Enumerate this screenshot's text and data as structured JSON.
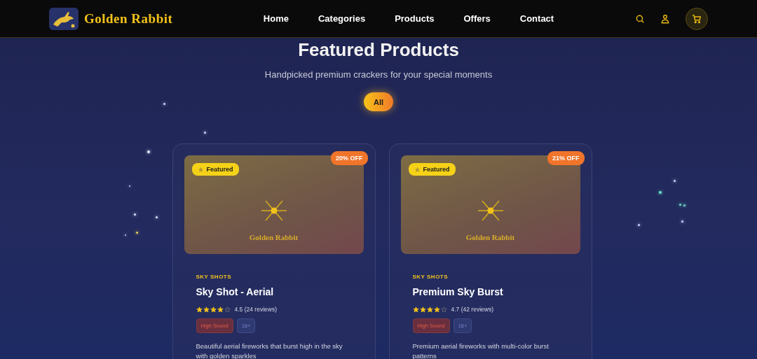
{
  "header": {
    "brand": "Golden Rabbit",
    "nav": [
      {
        "label": "Home",
        "selected": false
      },
      {
        "label": "Categories",
        "selected": false
      },
      {
        "label": "Products",
        "selected": false
      },
      {
        "label": "Offers",
        "selected": false
      },
      {
        "label": "Contact",
        "selected": false
      }
    ]
  },
  "section": {
    "title": "Featured Products",
    "subtitle": "Handpicked premium crackers for your special moments"
  },
  "filters": [
    {
      "label": "All",
      "selected": true
    }
  ],
  "products": [
    {
      "badge": "Featured",
      "discount": "20% OFF",
      "image_brand": "Golden Rabbit",
      "category": "SKY SHOTS",
      "name": "Sky Shot - Aerial",
      "stars": 4,
      "rating": "4.5 (24 reviews)",
      "tags": [
        {
          "label": "High Sound",
          "kind": "warning"
        },
        {
          "label": "18+",
          "kind": "info"
        }
      ],
      "description": "Beautiful aerial fireworks that burst high in the sky with golden sparkles"
    },
    {
      "badge": "Featured",
      "discount": "21% OFF",
      "image_brand": "Golden Rabbit",
      "category": "SKY SHOTS",
      "name": "Premium Sky Burst",
      "stars": 4,
      "rating": "4.7 (42 reviews)",
      "tags": [
        {
          "label": "High Sound",
          "kind": "warning"
        },
        {
          "label": "18+",
          "kind": "info"
        }
      ],
      "description": "Premium aerial fireworks with multi-color burst patterns"
    }
  ]
}
